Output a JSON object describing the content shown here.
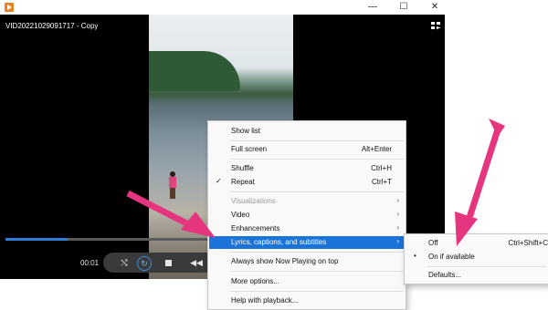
{
  "window": {
    "minimize_glyph": "—",
    "maximize_glyph": "☐",
    "close_glyph": "✕"
  },
  "player": {
    "video_title": "VID20221029091717 - Copy",
    "elapsed_time": "00:01",
    "seek_progress": 0.145,
    "controls": {
      "shuffle_glyph": "⤭",
      "repeat_glyph": "↻",
      "previous_glyph": "◀◀"
    }
  },
  "context_menu": {
    "items": [
      {
        "label": "Show list",
        "shortcut": "",
        "state": "normal"
      },
      {
        "label": "Full screen",
        "shortcut": "Alt+Enter",
        "state": "normal"
      },
      {
        "label": "Shuffle",
        "shortcut": "Ctrl+H",
        "state": "normal"
      },
      {
        "label": "Repeat",
        "shortcut": "Ctrl+T",
        "state": "checked",
        "check_glyph": "✓"
      },
      {
        "label": "Visualizations",
        "shortcut": "",
        "state": "disabled",
        "submenu_glyph": "›"
      },
      {
        "label": "Video",
        "shortcut": "",
        "state": "normal",
        "submenu_glyph": "›"
      },
      {
        "label": "Enhancements",
        "shortcut": "",
        "state": "normal",
        "submenu_glyph": "›"
      },
      {
        "label": "Lyrics, captions, and subtitles",
        "shortcut": "",
        "state": "highlighted",
        "submenu_glyph": "›"
      },
      {
        "label": "Always show Now Playing on top",
        "shortcut": "",
        "state": "normal"
      },
      {
        "label": "More options...",
        "shortcut": "",
        "state": "normal"
      },
      {
        "label": "Help with playback...",
        "shortcut": "",
        "state": "normal"
      }
    ]
  },
  "submenu": {
    "items": [
      {
        "label": "Off",
        "shortcut": "Ctrl+Shift+C",
        "state": "normal"
      },
      {
        "label": "On if available",
        "shortcut": "",
        "state": "selected",
        "radio_glyph": "•"
      },
      {
        "label": "Defaults...",
        "shortcut": "",
        "state": "normal"
      }
    ]
  },
  "colors": {
    "highlight": "#1a73d8",
    "annotation_arrow": "#e6357f",
    "seek_fill": "#2b7fd6"
  }
}
